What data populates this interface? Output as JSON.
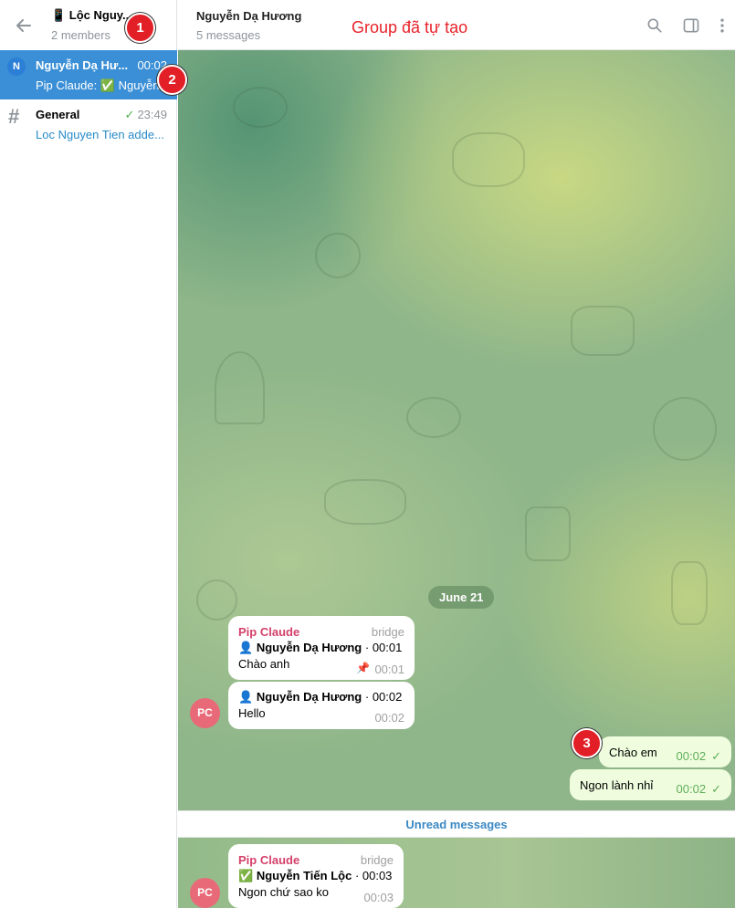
{
  "sidebar": {
    "back_icon": "arrow-left-icon",
    "title": "📱 Lộc Nguy...",
    "subtitle": "2 members",
    "chats": [
      {
        "avatar": "N",
        "name": "Nguyễn Dạ Hư...",
        "time": "00:02",
        "message": "Pip Claude: ✅ Nguyễn"
      },
      {
        "name": "General",
        "time": "23:49",
        "message": "Loc Nguyen Tien adde..."
      }
    ]
  },
  "header": {
    "title": "Nguyễn Dạ Hương",
    "subtitle": "5 messages",
    "note": "Group đã tự tạo",
    "icons": [
      "search-icon",
      "sidebar-toggle-icon",
      "more-vertical-icon"
    ]
  },
  "chat": {
    "date": "June 21",
    "messages": [
      {
        "sender": "Pip Claude",
        "tag": "bridge",
        "author": "Nguyễn Dạ Hương",
        "author_time": "· 00:01",
        "text": "Chào anh",
        "time": "00:01"
      },
      {
        "author": "Nguyễn Dạ Hương",
        "author_time": "· 00:02",
        "text": "Hello",
        "time": "00:02"
      },
      {
        "text": "Chào em",
        "time": "00:02"
      },
      {
        "text": "Ngon lành nhỉ",
        "time": "00:02"
      },
      {
        "sender": "Pip Claude",
        "tag": "bridge",
        "author": "Nguyễn Tiến Lộc",
        "author_time": "· 00:03",
        "text": "Ngon chứ sao ko",
        "time": "00:03"
      }
    ],
    "avatar_initials": "PC",
    "unread_label": "Unread messages"
  },
  "markers": [
    "1",
    "2",
    "3"
  ],
  "colors": {
    "accent": "#3a8fd6",
    "sender": "#d5406a",
    "marker": "#e21f26",
    "note": "#e8232a"
  }
}
